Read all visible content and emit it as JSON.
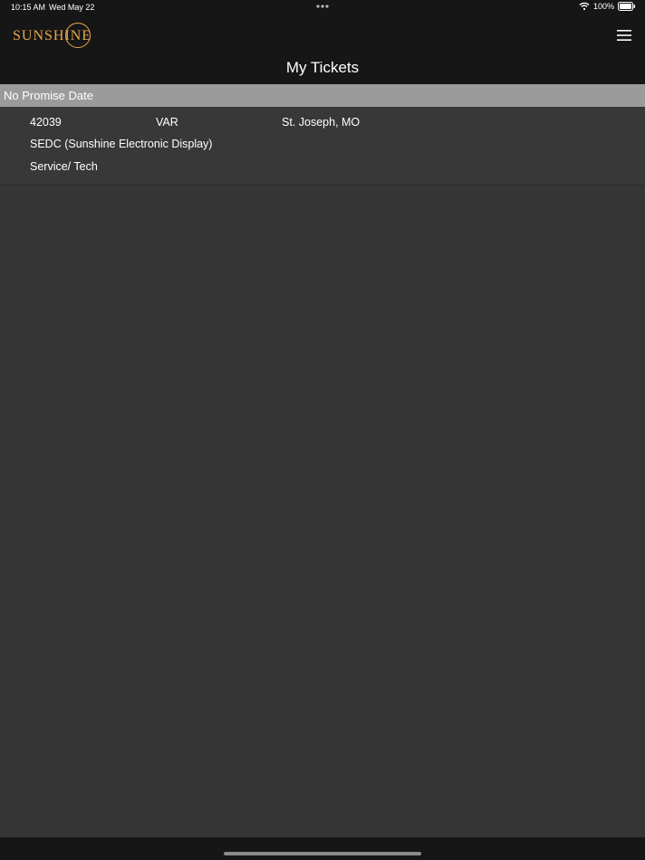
{
  "status": {
    "time": "10:15 AM",
    "date": "Wed May 22",
    "battery": "100%"
  },
  "app": {
    "logo_text": "SUNSHINE",
    "title": "My Tickets"
  },
  "sections": [
    {
      "header": "No Promise Date",
      "tickets": [
        {
          "number": "42039",
          "type": "VAR",
          "location": "St. Joseph, MO",
          "customer": "SEDC (Sunshine Electronic Display)",
          "category": "Service/ Tech"
        }
      ]
    }
  ],
  "colors": {
    "brand": "#e8a84b",
    "background": "#353535",
    "header_bg": "#161616",
    "section_bg": "#9b9b9b"
  },
  "icons": {
    "menu": "hamburger-menu-icon",
    "wifi": "wifi-icon",
    "battery": "battery-icon",
    "multitask": "more-dots-icon"
  }
}
